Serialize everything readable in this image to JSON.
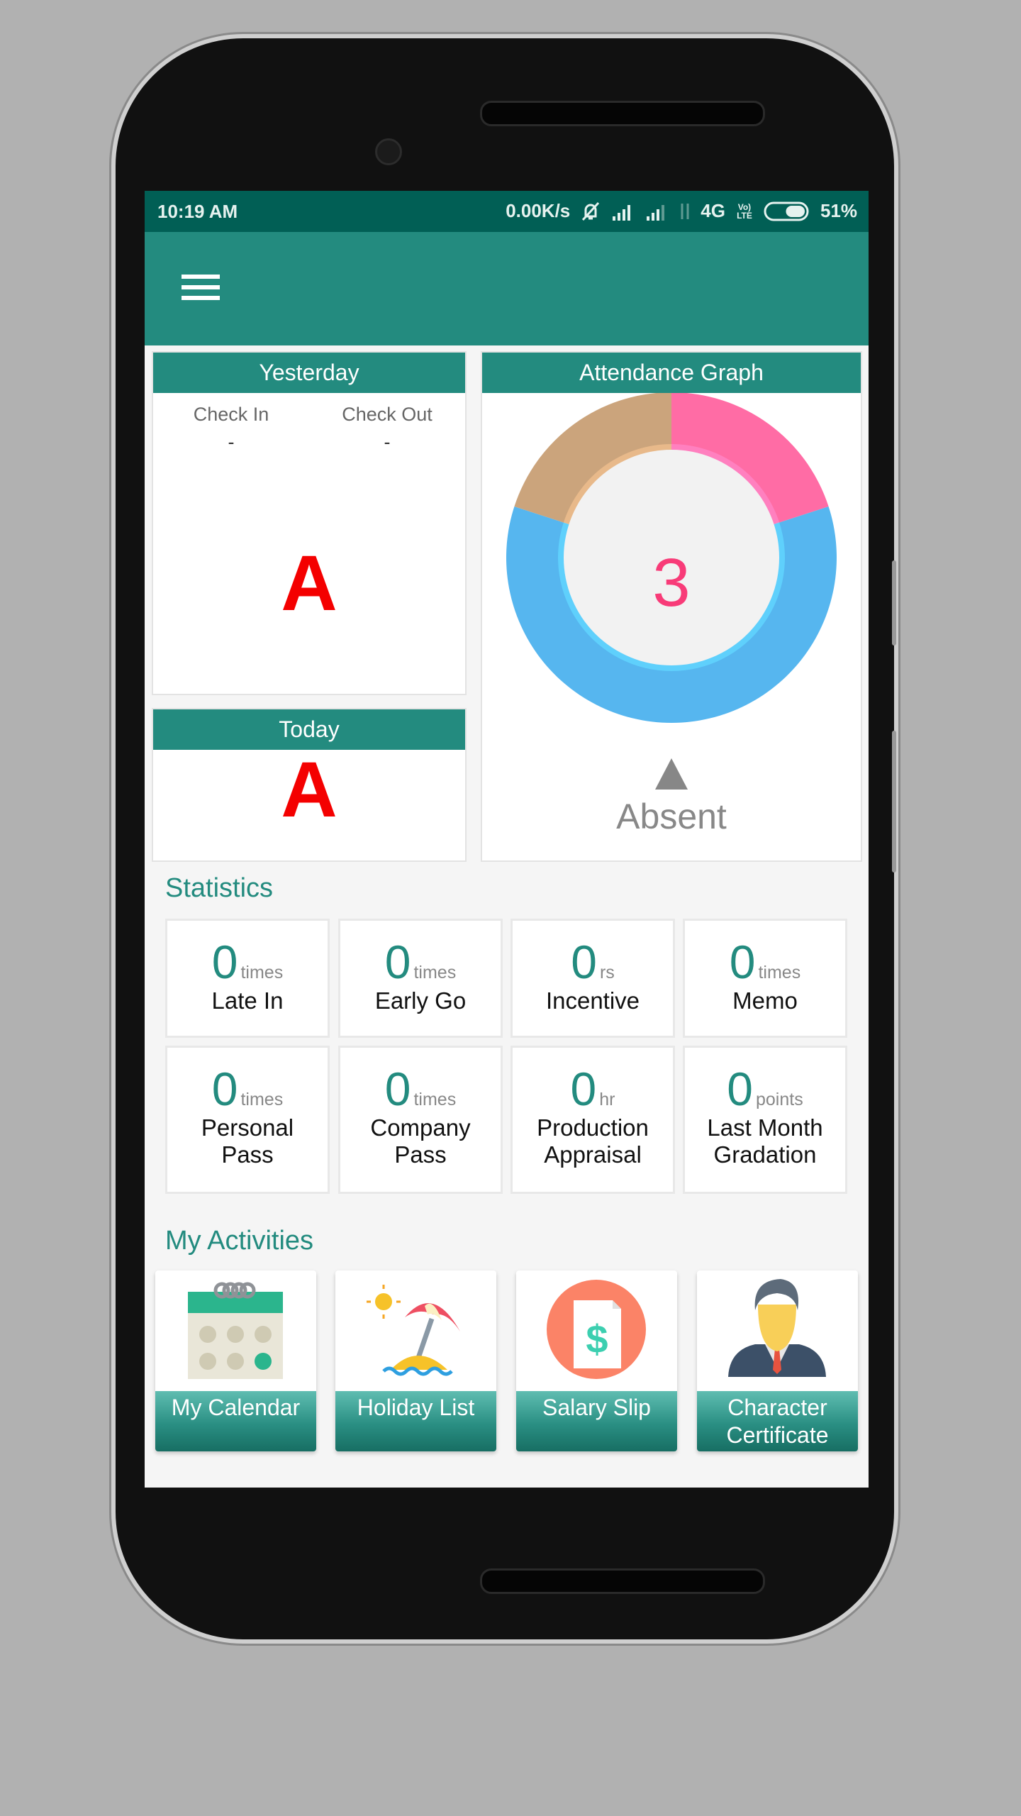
{
  "status_bar": {
    "time": "10:19 AM",
    "net_speed": "0.00K/s",
    "network": "4G",
    "volte": "Vo) LTE",
    "battery": "51%",
    "battery_level": 51
  },
  "header": {
    "menu_icon": "hamburger-icon"
  },
  "yesterday": {
    "title": "Yesterday",
    "check_in_label": "Check In",
    "check_in_value": "-",
    "check_out_label": "Check Out",
    "check_out_value": "-",
    "status": "A"
  },
  "today": {
    "title": "Today",
    "status": "A"
  },
  "attendance_graph": {
    "title": "Attendance Graph",
    "center_value": "3",
    "selected_label": "Absent"
  },
  "chart_data": {
    "type": "pie",
    "donut": true,
    "values": [
      1,
      3,
      1
    ],
    "colors": [
      "#ff6ca5",
      "#56b6ef",
      "#cba47c"
    ],
    "center_value": "3",
    "selected": "Absent"
  },
  "statistics": {
    "title": "Statistics",
    "items": [
      {
        "value": "0",
        "unit": "times",
        "label": "Late In"
      },
      {
        "value": "0",
        "unit": "times",
        "label": "Early Go"
      },
      {
        "value": "0",
        "unit": "rs",
        "label": "Incentive"
      },
      {
        "value": "0",
        "unit": "times",
        "label": "Memo"
      },
      {
        "value": "0",
        "unit": "times",
        "label": "Personal Pass"
      },
      {
        "value": "0",
        "unit": "times",
        "label": "Company Pass"
      },
      {
        "value": "0",
        "unit": "hr",
        "label": "Production Appraisal"
      },
      {
        "value": "0",
        "unit": "points",
        "label": "Last Month Gradation"
      }
    ]
  },
  "activities": {
    "title": "My Activities",
    "items": [
      {
        "label": "My Calendar",
        "icon": "calendar-icon"
      },
      {
        "label": "Holiday List",
        "icon": "beach-umbrella-icon"
      },
      {
        "label": "Salary Slip",
        "icon": "salary-slip-icon"
      },
      {
        "label": "Character Certificate",
        "icon": "person-icon"
      }
    ]
  }
}
